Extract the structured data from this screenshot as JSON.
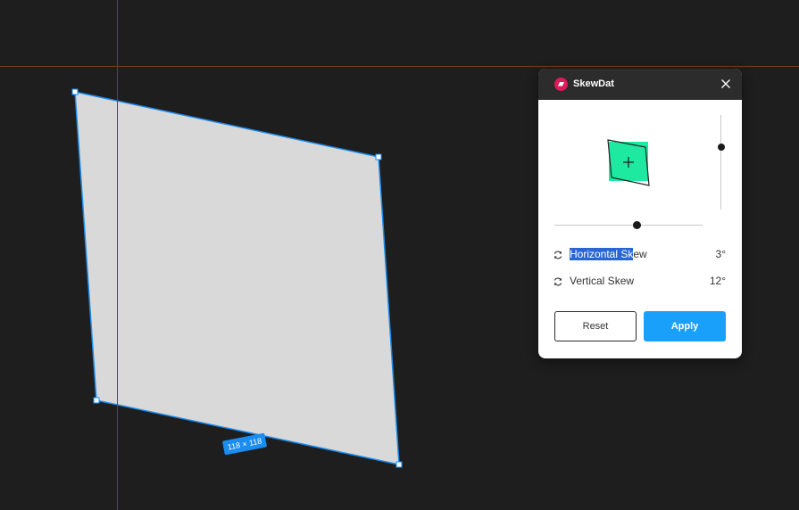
{
  "canvas": {
    "size_label": "118 × 118",
    "shape_fill": "#d9d9d9",
    "selection_color": "#1b8cf0",
    "guide_color": "#7a3a2a"
  },
  "plugin": {
    "name": "SkewDat",
    "logo_color": "#e0195a",
    "preview_fill": "#1de9a0",
    "horizontal_skew": {
      "label_selected": "Horizontal Sk",
      "label_rest": "ew",
      "value": "3°"
    },
    "vertical_skew": {
      "label": "Vertical Skew",
      "value": "12°"
    },
    "reset_label": "Reset",
    "apply_label": "Apply",
    "accent_color": "#18a0fb",
    "icons": {
      "close": "close-icon",
      "reset": "rotate-icon",
      "preview_center": "plus-icon"
    }
  }
}
